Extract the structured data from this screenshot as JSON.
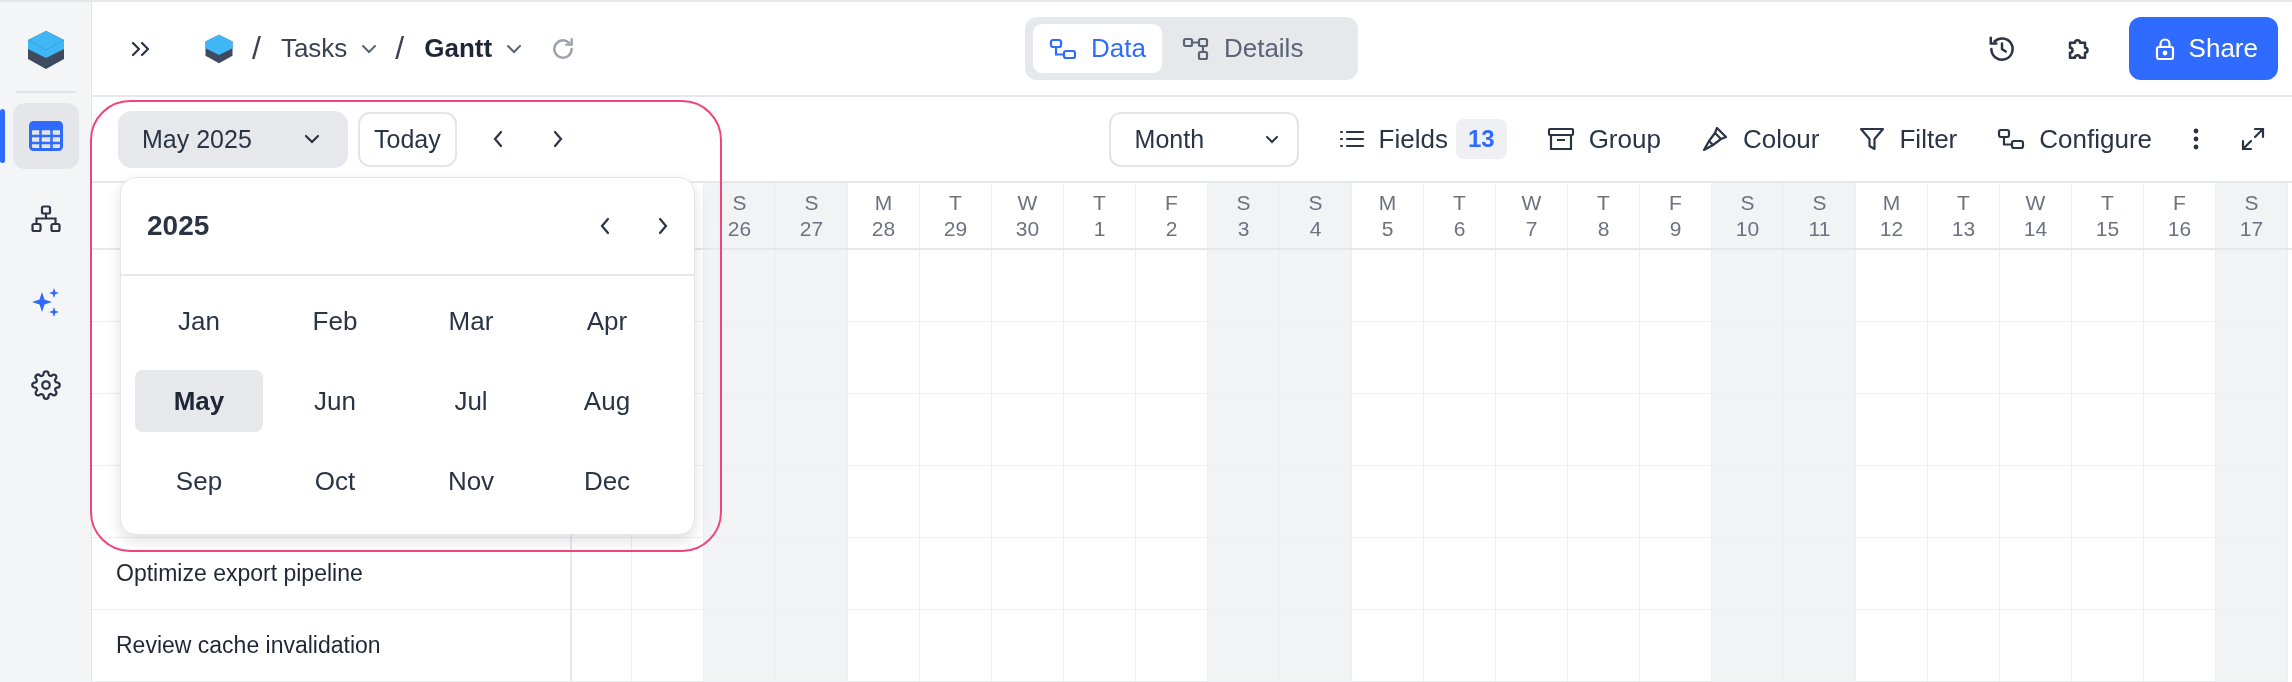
{
  "sidebar": {
    "items": [
      {
        "kind": "table",
        "selected": true
      },
      {
        "kind": "hierarchy",
        "selected": false
      },
      {
        "kind": "sparkle",
        "selected": false
      },
      {
        "kind": "settings",
        "selected": false
      }
    ]
  },
  "breadcrumb": [
    {
      "separator": "/",
      "label": "Tasks",
      "current": false
    },
    {
      "separator": "/",
      "label": "Gantt",
      "current": true
    }
  ],
  "view_switch": [
    {
      "kind": "data",
      "label": "Data",
      "selected": true
    },
    {
      "kind": "details",
      "label": "Details",
      "selected": false
    }
  ],
  "share_button": {
    "label": "Share"
  },
  "toolbar": {
    "period": "May 2025",
    "today": "Today",
    "scale": "Month",
    "fields": {
      "label": "Fields",
      "count": "13"
    },
    "actions": [
      {
        "kind": "group",
        "label": "Group"
      },
      {
        "kind": "colour",
        "label": "Colour"
      },
      {
        "kind": "filter",
        "label": "Filter"
      },
      {
        "kind": "configure",
        "label": "Configure"
      }
    ]
  },
  "month_picker": {
    "year": "2025",
    "months": [
      {
        "label": "Jan",
        "selected": false
      },
      {
        "label": "Feb",
        "selected": false
      },
      {
        "label": "Mar",
        "selected": false
      },
      {
        "label": "Apr",
        "selected": false
      },
      {
        "label": "May",
        "selected": true
      },
      {
        "label": "Jun",
        "selected": false
      },
      {
        "label": "Jul",
        "selected": false
      },
      {
        "label": "Aug",
        "selected": false
      },
      {
        "label": "Sep",
        "selected": false
      },
      {
        "label": "Oct",
        "selected": false
      },
      {
        "label": "Nov",
        "selected": false
      },
      {
        "label": "Dec",
        "selected": false
      }
    ]
  },
  "timeline": {
    "days": [
      {
        "weekday": "S",
        "day": "26",
        "weekend": true
      },
      {
        "weekday": "S",
        "day": "27",
        "weekend": true
      },
      {
        "weekday": "M",
        "day": "28",
        "weekend": false
      },
      {
        "weekday": "T",
        "day": "29",
        "weekend": false
      },
      {
        "weekday": "W",
        "day": "30",
        "weekend": false
      },
      {
        "weekday": "T",
        "day": "1",
        "weekend": false
      },
      {
        "weekday": "F",
        "day": "2",
        "weekend": false
      },
      {
        "weekday": "S",
        "day": "3",
        "weekend": true
      },
      {
        "weekday": "S",
        "day": "4",
        "weekend": true
      },
      {
        "weekday": "M",
        "day": "5",
        "weekend": false
      },
      {
        "weekday": "T",
        "day": "6",
        "weekend": false
      },
      {
        "weekday": "W",
        "day": "7",
        "weekend": false
      },
      {
        "weekday": "T",
        "day": "8",
        "weekend": false
      },
      {
        "weekday": "F",
        "day": "9",
        "weekend": false
      },
      {
        "weekday": "S",
        "day": "10",
        "weekend": true
      },
      {
        "weekday": "S",
        "day": "11",
        "weekend": true
      },
      {
        "weekday": "M",
        "day": "12",
        "weekend": false
      },
      {
        "weekday": "T",
        "day": "13",
        "weekend": false
      },
      {
        "weekday": "W",
        "day": "14",
        "weekend": false
      },
      {
        "weekday": "T",
        "day": "15",
        "weekend": false
      },
      {
        "weekday": "F",
        "day": "16",
        "weekend": false
      },
      {
        "weekday": "S",
        "day": "17",
        "weekend": true
      }
    ]
  },
  "tasks": [
    {
      "name": "Optimize export pipeline"
    },
    {
      "name": "Review cache invalidation"
    }
  ]
}
